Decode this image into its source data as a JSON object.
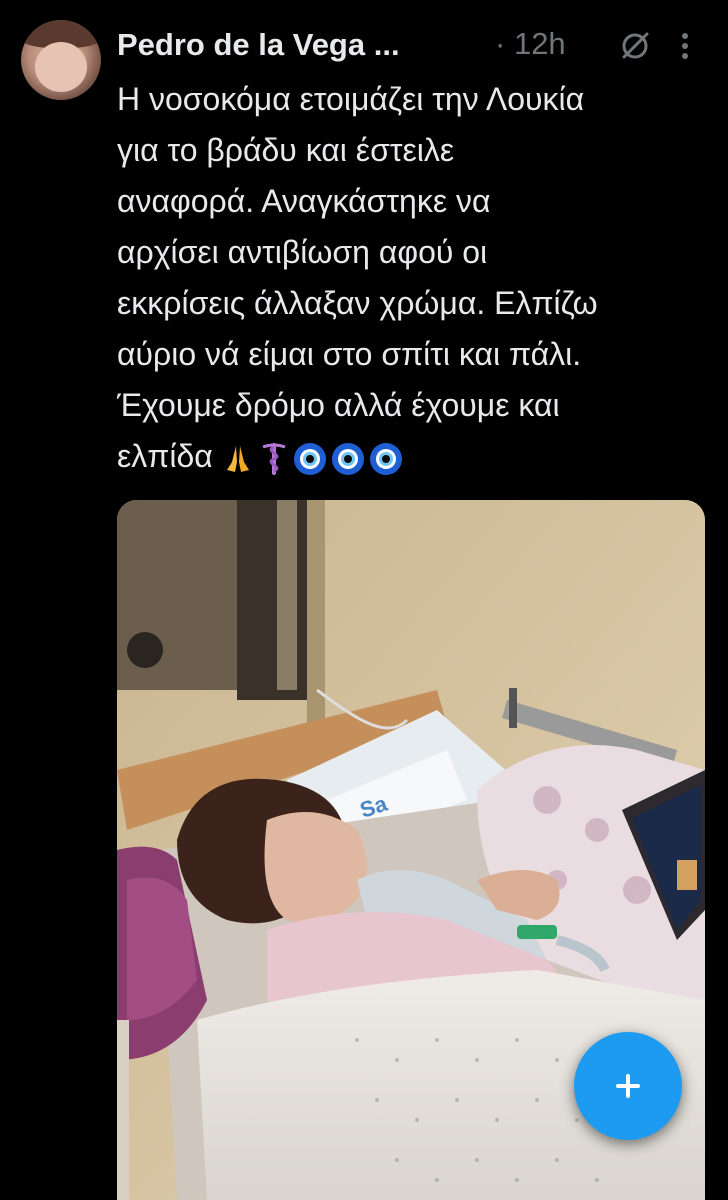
{
  "tweet": {
    "author_name": "Pedro de la Vega ...",
    "separator": "·",
    "time_ago": "12h",
    "text": "Η νοσοκόμα ετοιμάζει την Λουκία\nγια το βράδυ και έστειλε\nαναφορά. Αναγκάστηκε να\nαρχίσει αντιβίωση αφού οι\nεκκρίσεις άλλαξαν χρώμα. Ελπίζω\nαύριο νά είμαι στο σπίτι και πάλι.\nΈχουμε δρόμο αλλά έχουμε και\nελπίδα",
    "emojis": [
      "pray-icon",
      "caduceus-icon",
      "nazar-eye-icon",
      "nazar-eye-icon",
      "nazar-eye-icon"
    ],
    "photo_label": "Sa"
  },
  "colors": {
    "background": "#000000",
    "text_primary": "#e7e9ea",
    "text_secondary": "#71767b",
    "accent": "#1d9bf0"
  },
  "fab": {
    "icon": "plus-icon"
  }
}
